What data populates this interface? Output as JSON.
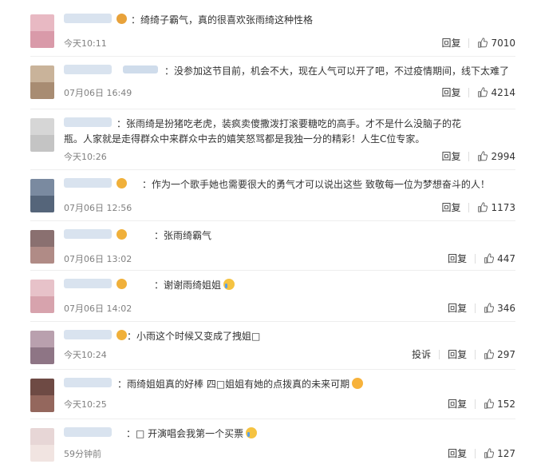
{
  "comments": [
    {
      "text": "绮绮子霸气，真的很喜欢张雨绮这种性格",
      "time": "今天10:11",
      "reply": "回复",
      "likes": "7010",
      "colors": [
        "#e8b9c3",
        "#d99aa9"
      ],
      "badge": "#e8a23a",
      "emoji": ""
    },
    {
      "text": "没参加这节目前，机会不大，现在人气可以开了吧，不过疫情期间，线下太难了",
      "time": "07月06日 16:49",
      "reply": "回复",
      "likes": "4214",
      "colors": [
        "#c9b39a",
        "#a88c72"
      ],
      "badge": "",
      "emoji": ""
    },
    {
      "text": "张雨绮是扮猪吃老虎，装疯卖傻撒泼打滚要糖吃的高手。才不是什么没脑子的花瓶。人家就是走得群众中来群众中去的嬉笑怒骂都是我独一分的精彩！人生C位专家。",
      "time": "今天10:26",
      "reply": "回复",
      "likes": "2994",
      "colors": [
        "#d6d6d6",
        "#c4c4c4"
      ],
      "badge": "",
      "emoji": ""
    },
    {
      "text": "作为一个歌手她也需要很大的勇气才可以说出这些 致敬每一位为梦想奋斗的人！",
      "time": "07月06日 12:56",
      "reply": "回复",
      "likes": "1173",
      "colors": [
        "#7a8aa0",
        "#55657a"
      ],
      "badge": "#f0b03a",
      "emoji": ""
    },
    {
      "text": "张雨绮霸气",
      "time": "07月06日 13:02",
      "reply": "回复",
      "likes": "447",
      "colors": [
        "#8a7070",
        "#b08b86"
      ],
      "badge": "#f0b03a",
      "emoji": ""
    },
    {
      "text": "谢谢雨绮姐姐",
      "time": "07月06日 14:02",
      "reply": "回复",
      "likes": "346",
      "colors": [
        "#e7c2c9",
        "#d7a3ad"
      ],
      "badge": "#f0b03a",
      "emoji": "cry"
    },
    {
      "text": "小雨这个时候又变成了拽姐□",
      "time": "今天10:24",
      "report": "投诉",
      "reply": "回复",
      "likes": "297",
      "colors": [
        "#b9a0ae",
        "#8e7585"
      ],
      "badge": "#f0b03a",
      "emoji": ""
    },
    {
      "text": "雨绮姐姐真的好棒 四□姐姐有她的点拨真的未来可期",
      "time": "今天10:25",
      "reply": "回复",
      "likes": "152",
      "colors": [
        "#6e4a44",
        "#94675d"
      ],
      "badge": "",
      "emoji": "kiss"
    },
    {
      "text": "□ 开演唱会我第一个买票",
      "time": "59分钟前",
      "reply": "回复",
      "likes": "127",
      "colors": [
        "#e7d6d6",
        "#f1e4e1"
      ],
      "badge": "",
      "emoji": "cry"
    }
  ]
}
